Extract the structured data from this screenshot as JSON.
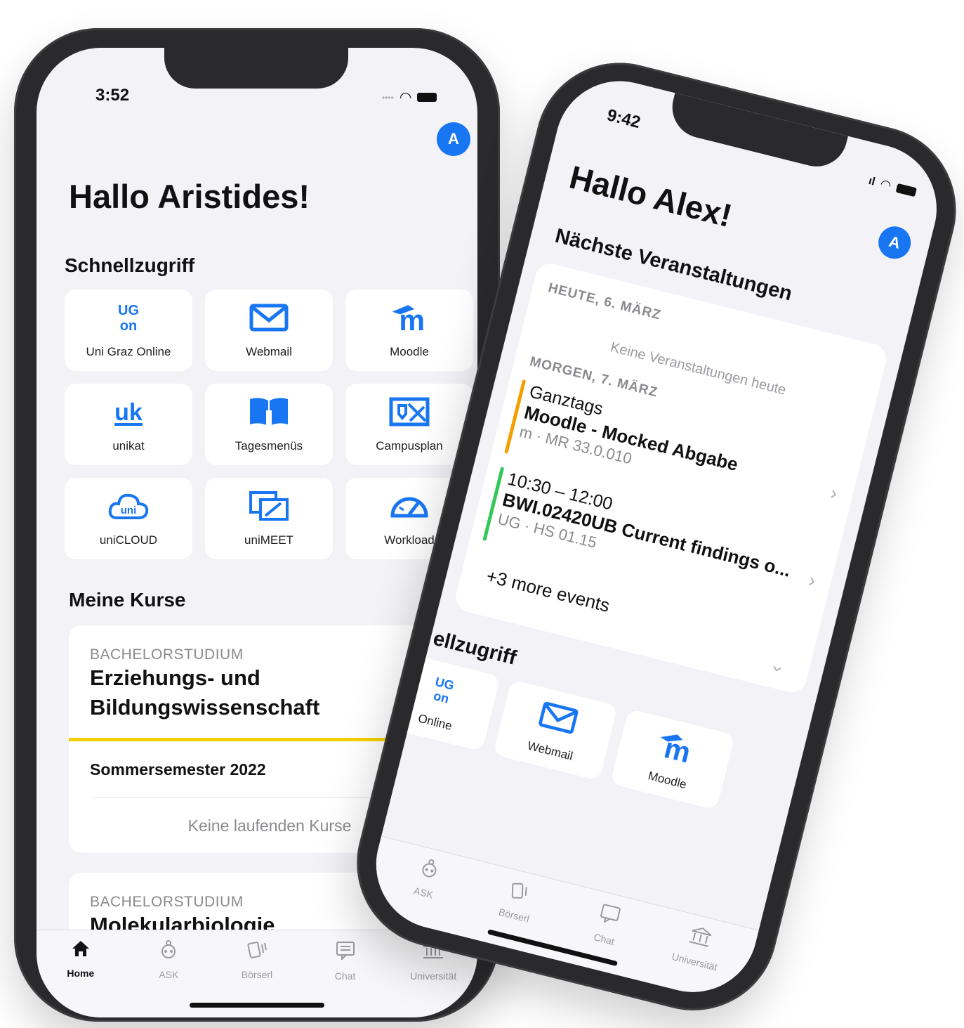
{
  "left_phone": {
    "status_time": "3:52",
    "avatar_initial": "A",
    "greeting": "Hallo Aristides!",
    "quick_access_title": "Schnellzugriff",
    "tiles": [
      {
        "label": "Uni Graz Online",
        "icon": "ugo-logo-icon"
      },
      {
        "label": "Webmail",
        "icon": "envelope-icon"
      },
      {
        "label": "Moodle",
        "icon": "moodle-icon"
      },
      {
        "label": "unikat",
        "icon": "unikat-logo-icon"
      },
      {
        "label": "Tagesmenüs",
        "icon": "menu-book-icon"
      },
      {
        "label": "Campusplan",
        "icon": "map-icon"
      },
      {
        "label": "uniCLOUD",
        "icon": "cloud-icon"
      },
      {
        "label": "uniMEET",
        "icon": "meeting-icon"
      },
      {
        "label": "Workload",
        "icon": "gauge-icon"
      }
    ],
    "courses_title": "Meine Kurse",
    "courses": [
      {
        "kind": "BACHELORSTUDIUM",
        "name_line1": "Erziehungs- und",
        "name_line2": "Bildungswissenschaft",
        "semester": "Sommersemester 2022",
        "empty_text": "Keine laufenden Kurse"
      },
      {
        "kind": "BACHELORSTUDIUM",
        "name_line1": "Molekularbiologie"
      }
    ],
    "tabs": [
      {
        "label": "Home",
        "icon": "home-icon"
      },
      {
        "label": "ASK",
        "icon": "robot-icon"
      },
      {
        "label": "Börserl",
        "icon": "cards-icon"
      },
      {
        "label": "Chat",
        "icon": "chat-icon"
      },
      {
        "label": "Universität",
        "icon": "university-icon"
      }
    ],
    "colors": {
      "accent": "#1976f3",
      "highlight": "#f5d000",
      "background": "#f2f2f7"
    }
  },
  "right_phone": {
    "status_time": "9:42",
    "avatar_initial": "A",
    "greeting": "Hallo Alex!",
    "events_title": "Nächste Veranstaltungen",
    "today_header": "HEUTE, 6. MÄRZ",
    "today_empty": "Keine Veranstaltungen heute",
    "tomorrow_header": "MORGEN, 7. MÄRZ",
    "events": [
      {
        "time": "Ganztags",
        "title": "Moodle - Mocked Abgabe",
        "source": "m",
        "room": "· MR 33.0.010",
        "color": "#f2a000"
      },
      {
        "time": "10:30 – 12:00",
        "title": "BWI.02420UB Current findings o...",
        "source": "UG",
        "room": "· HS 01.15",
        "color": "#34c759"
      }
    ],
    "more_events": "+3 more events",
    "quick_access_title": "ellzugriff",
    "tiles": [
      {
        "label": "Online",
        "icon": "ugo-logo-icon"
      },
      {
        "label": "Webmail",
        "icon": "envelope-icon"
      },
      {
        "label": "Moodle",
        "icon": "moodle-icon"
      }
    ],
    "tabs": [
      {
        "label": "ASK",
        "icon": "robot-icon"
      },
      {
        "label": "Börserl",
        "icon": "cards-icon"
      },
      {
        "label": "Chat",
        "icon": "chat-icon"
      },
      {
        "label": "Universität",
        "icon": "university-icon"
      }
    ]
  }
}
